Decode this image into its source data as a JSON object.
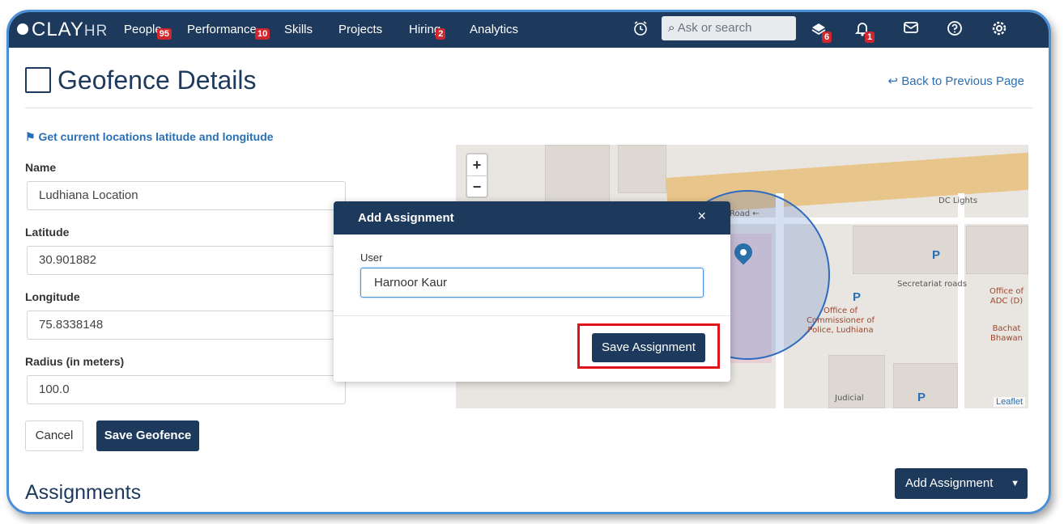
{
  "nav": {
    "logo_main": "CLAY",
    "logo_sub": "HR",
    "items": [
      {
        "label": "People",
        "badge": "95"
      },
      {
        "label": "Performance",
        "badge": "10"
      },
      {
        "label": "Skills",
        "badge": ""
      },
      {
        "label": "Projects",
        "badge": ""
      },
      {
        "label": "Hiring",
        "badge": "2"
      },
      {
        "label": "Analytics",
        "badge": ""
      }
    ],
    "search_placeholder": "Ask or search",
    "inbox_badge": "6",
    "notifications_badge": "1"
  },
  "page": {
    "title": "Geofence Details",
    "back_link": "↩ Back to Previous Page",
    "get_location": "⚑ Get current locations latitude and longitude"
  },
  "form": {
    "name_label": "Name",
    "name_value": "Ludhiana Location",
    "latitude_label": "Latitude",
    "latitude_value": "30.901882",
    "longitude_label": "Longitude",
    "longitude_value": "75.8338148",
    "radius_label": "Radius (in meters)",
    "radius_value": "100.0",
    "cancel_label": "Cancel",
    "save_label": "Save Geofence"
  },
  "assignments": {
    "title": "Assignments",
    "add_label": "Add Assignment"
  },
  "map": {
    "zoom_in": "+",
    "zoom_out": "−",
    "labels": {
      "road": "Road ←",
      "dc_lights": "DC Lights",
      "secretariat": "Secretariat roads",
      "office_commissioner": "Office of Commissioner of Police, Ludhiana",
      "office_adc": "Office of ADC (D)",
      "bachat_bhawan": "Bachat Bhawan",
      "judicial": "Judicial",
      "parking": "P"
    },
    "attribution": "Leaflet"
  },
  "modal": {
    "title": "Add Assignment",
    "close": "×",
    "user_label": "User",
    "user_value": "Harnoor Kaur",
    "save_label": "Save Assignment"
  },
  "colors": {
    "navy": "#1d3a5c",
    "link_blue": "#2a6fb4",
    "badge_red": "#d0262d",
    "highlight_red": "#e0141b"
  }
}
